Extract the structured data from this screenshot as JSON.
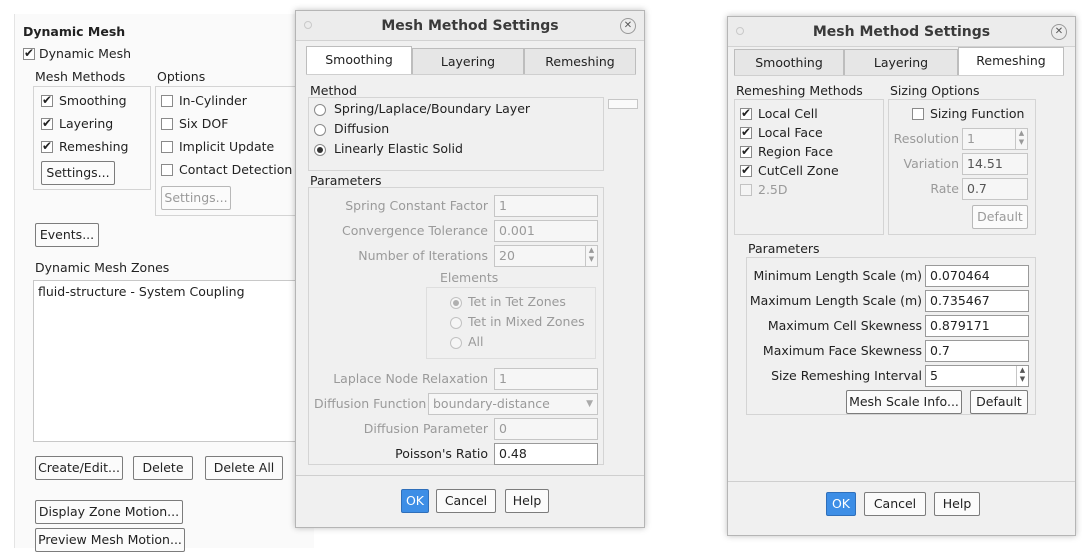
{
  "main_panel": {
    "title": "Dynamic Mesh",
    "dynamic_mesh_label": "Dynamic Mesh",
    "mesh_methods_label": "Mesh Methods",
    "options_label": "Options",
    "methods": [
      "Smoothing",
      "Layering",
      "Remeshing"
    ],
    "options": [
      "In-Cylinder",
      "Six DOF",
      "Implicit Update",
      "Contact Detection"
    ],
    "settings_button": "Settings...",
    "options_settings_button": "Settings...",
    "events_button": "Events...",
    "zones_label": "Dynamic Mesh Zones",
    "zones": [
      "fluid-structure - System Coupling"
    ],
    "create_edit_button": "Create/Edit...",
    "delete_button": "Delete",
    "delete_all_button": "Delete All",
    "display_zone_motion_button": "Display Zone Motion...",
    "preview_mesh_motion_button": "Preview Mesh Motion..."
  },
  "dialog1": {
    "title": "Mesh Method Settings",
    "close": "✕",
    "tabs": [
      "Smoothing",
      "Layering",
      "Remeshing"
    ],
    "method_label": "Method",
    "methods": [
      "Spring/Laplace/Boundary Layer",
      "Diffusion",
      "Linearly Elastic Solid"
    ],
    "parameters_label": "Parameters",
    "spring_constant_label": "Spring Constant Factor",
    "spring_constant_value": "1",
    "convergence_label": "Convergence Tolerance",
    "convergence_value": "0.001",
    "iterations_label": "Number of Iterations",
    "iterations_value": "20",
    "elements_label": "Elements",
    "elements": [
      "Tet in Tet Zones",
      "Tet in Mixed Zones",
      "All"
    ],
    "laplace_label": "Laplace Node Relaxation",
    "laplace_value": "1",
    "diffusion_function_label": "Diffusion Function",
    "diffusion_function_value": "boundary-distance",
    "diffusion_parameter_label": "Diffusion Parameter",
    "diffusion_parameter_value": "0",
    "poisson_label": "Poisson's Ratio",
    "poisson_value": "0.48",
    "ok_button": "OK",
    "cancel_button": "Cancel",
    "help_button": "Help"
  },
  "dialog2": {
    "title": "Mesh Method Settings",
    "close": "✕",
    "tabs": [
      "Smoothing",
      "Layering",
      "Remeshing"
    ],
    "remeshing_methods_label": "Remeshing Methods",
    "remeshing_methods": [
      "Local Cell",
      "Local Face",
      "Region Face",
      "CutCell Zone",
      "2.5D"
    ],
    "sizing_options_label": "Sizing Options",
    "sizing_function_label": "Sizing Function",
    "resolution_label": "Resolution",
    "resolution_value": "1",
    "variation_label": "Variation",
    "variation_value": "14.51",
    "rate_label": "Rate",
    "rate_value": "0.7",
    "default_button": "Default",
    "parameters_label": "Parameters",
    "min_length_label": "Minimum Length Scale (m)",
    "min_length_value": "0.070464",
    "max_length_label": "Maximum Length Scale (m)",
    "max_length_value": "0.735467",
    "max_cell_skew_label": "Maximum Cell Skewness",
    "max_cell_skew_value": "0.879171",
    "max_face_skew_label": "Maximum Face Skewness",
    "max_face_skew_value": "0.7",
    "size_interval_label": "Size Remeshing Interval",
    "size_interval_value": "5",
    "mesh_scale_info_button": "Mesh Scale Info...",
    "default_button2": "Default",
    "ok_button": "OK",
    "cancel_button": "Cancel",
    "help_button": "Help"
  },
  "colors": {
    "accent": "#3d8ee6",
    "dialog_bg": "#f0f0f0",
    "disabled_text": "#9a9a9a"
  }
}
